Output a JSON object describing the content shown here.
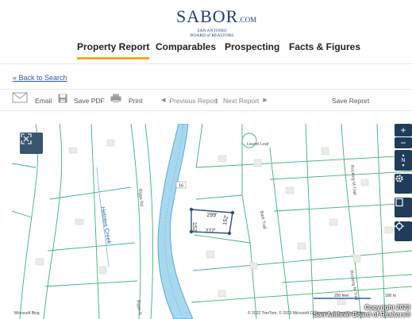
{
  "logo": {
    "main": "SABOR",
    "suffix": ".COM",
    "sub1": "SAN ANTONIO",
    "sub2": "BOARD of REALTORS"
  },
  "tabs": [
    {
      "label": "Property Report",
      "active": true
    },
    {
      "label": "Comparables"
    },
    {
      "label": "Prospecting"
    },
    {
      "label": "Facts & Figures"
    }
  ],
  "back_link": "« Back to Search",
  "toolbar": {
    "email": "Email",
    "save_pdf": "Save PDF",
    "print": "Print",
    "prev": "Previous Report",
    "sep": "|",
    "next": "Next Report",
    "save_report": "Save Report"
  },
  "map": {
    "labels": {
      "road_16": "16",
      "creek": "Helotes Creek",
      "laurel_leaf": "Laurel Leaf",
      "biggs_rd": "Biggs Rd",
      "biggs_rd_2": "Biggs R",
      "bark_trail": "Bark Trail",
      "rocking_m_trail": "Rocking M Trail",
      "rocking_m_trail_2": "Rocking M Trail",
      "dim_top": "299'",
      "dim_bottom": "272'",
      "dim_left": "152'",
      "dim_right": "152'"
    },
    "scale_feet": "250 feet",
    "scale_m": "100 m",
    "attribution": "© 2022 TomTom, © 2023 Microsoft Corporation, © OpenStreetMap",
    "bing_logo": "Microsoft Bing",
    "copyright_1": "Copyright 2023",
    "copyright_2": "San Antonio Board of Realtors®",
    "controls": {
      "zoom_in": "+",
      "zoom_out": "−",
      "north": "N"
    }
  },
  "colors": {
    "accent": "#f5a623",
    "parcel_line": "#3cb371",
    "water": "#a8d8f0",
    "control_bg": "#1f3d5a"
  }
}
